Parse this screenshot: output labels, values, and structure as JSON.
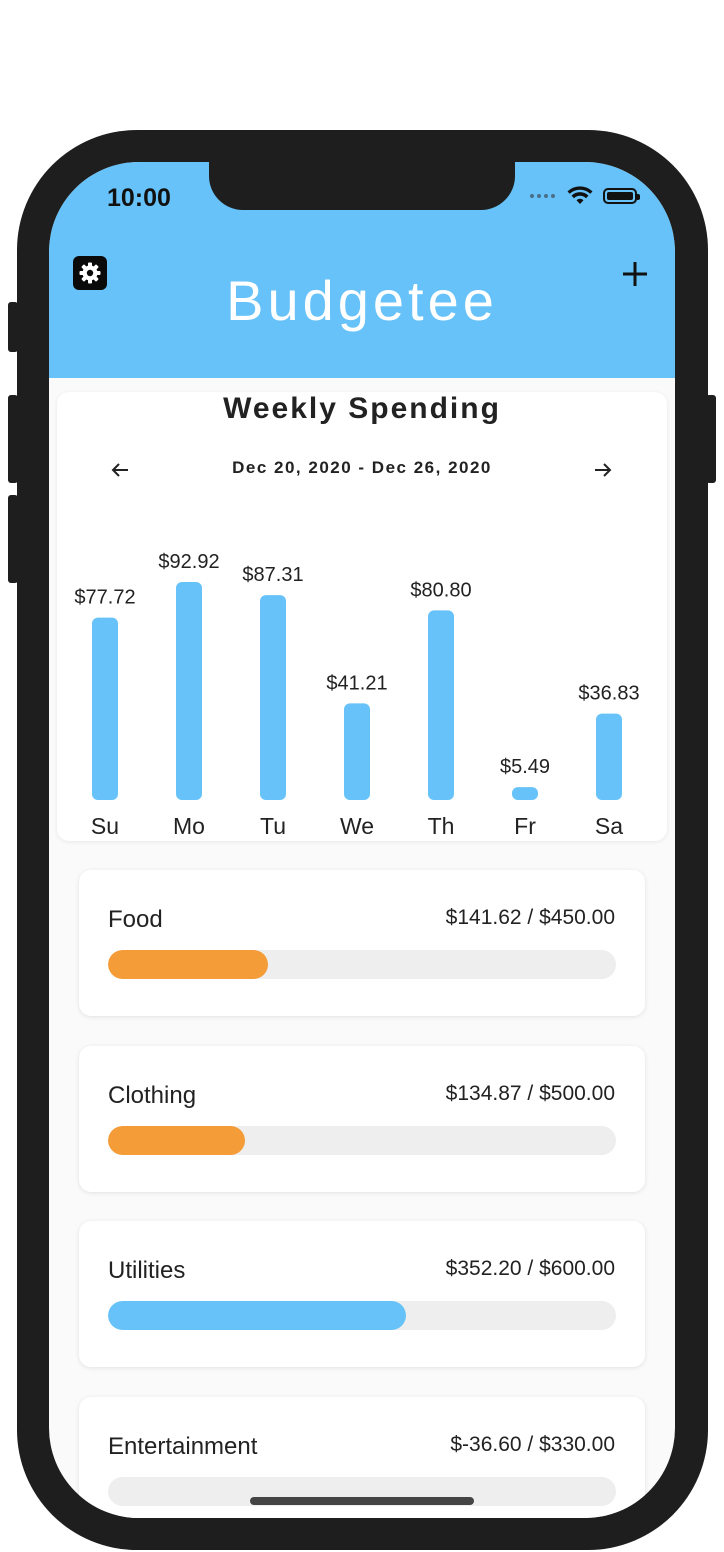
{
  "status_bar": {
    "time": "10:00"
  },
  "app_bar": {
    "title": "Budgetee",
    "settings_icon": "gear-icon",
    "add_icon": "plus-icon",
    "color": "#66c2f8"
  },
  "weekly_spending": {
    "title": "Weekly Spending",
    "date_range": "Dec 20, 2020 - Dec 26, 2020",
    "prev_icon": "arrow-left-icon",
    "next_icon": "arrow-right-icon"
  },
  "chart_data": {
    "type": "bar",
    "title": "Weekly Spending",
    "categories": [
      "Su",
      "Mo",
      "Tu",
      "We",
      "Th",
      "Fr",
      "Sa"
    ],
    "values": [
      77.72,
      92.92,
      87.31,
      41.21,
      80.8,
      5.49,
      36.83
    ],
    "value_labels": [
      "$77.72",
      "$92.92",
      "$87.31",
      "$41.21",
      "$80.80",
      "$5.49",
      "$36.83"
    ],
    "xlabel": "",
    "ylabel": "",
    "ylim": [
      0,
      92.92
    ],
    "grid": false,
    "bar_color": "#66c2f8"
  },
  "budgets": [
    {
      "name": "Food",
      "amount": "$141.62 / $450.00",
      "fraction": 0.3147,
      "color": "#f39c38"
    },
    {
      "name": "Clothing",
      "amount": "$134.87 / $500.00",
      "fraction": 0.2697,
      "color": "#f39c38"
    },
    {
      "name": "Utilities",
      "amount": "$352.20 / $600.00",
      "fraction": 0.587,
      "color": "#66c2f8"
    },
    {
      "name": "Entertainment",
      "amount": "$-36.60 / $330.00",
      "fraction": 0,
      "color": "#66c2f8"
    }
  ]
}
